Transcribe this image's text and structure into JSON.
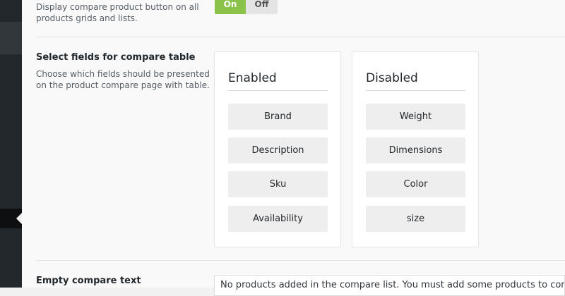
{
  "show_button": {
    "description": [
      "Display compare product button on all",
      "products grids and lists."
    ],
    "toggle": {
      "on_label": "On",
      "off_label": "Off",
      "selected": "On"
    }
  },
  "fields": {
    "label": "Select fields for compare table",
    "description": [
      "Choose which fields should be presented",
      "on the product compare page with table."
    ],
    "enabled": {
      "title": "Enabled",
      "items": [
        "Brand",
        "Description",
        "Sku",
        "Availability"
      ]
    },
    "disabled": {
      "title": "Disabled",
      "items": [
        "Weight",
        "Dimensions",
        "Color",
        "size"
      ]
    }
  },
  "empty_text": {
    "label": "Empty compare text",
    "value": "No products added in the compare list. You must add some products to compare them."
  },
  "colors": {
    "toggle_on": "#8bc34a",
    "sidebar": "#23282d"
  }
}
